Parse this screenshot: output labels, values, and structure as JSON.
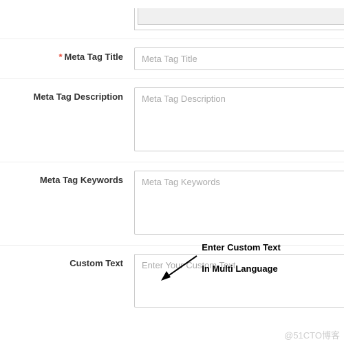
{
  "fields": {
    "meta_title": {
      "label": "Meta Tag Title",
      "required_marker": "*",
      "placeholder": "Meta Tag Title",
      "value": ""
    },
    "meta_description": {
      "label": "Meta Tag Description",
      "placeholder": "Meta Tag Description",
      "value": ""
    },
    "meta_keywords": {
      "label": "Meta Tag Keywords",
      "placeholder": "Meta Tag Keywords",
      "value": ""
    },
    "custom_text": {
      "label": "Custom Text",
      "placeholder": "Enter Your Custom Text",
      "value": ""
    }
  },
  "annotation": {
    "line1": "Enter Custom Text",
    "line2": "In Multi Language"
  },
  "watermark": "@51CTO博客"
}
